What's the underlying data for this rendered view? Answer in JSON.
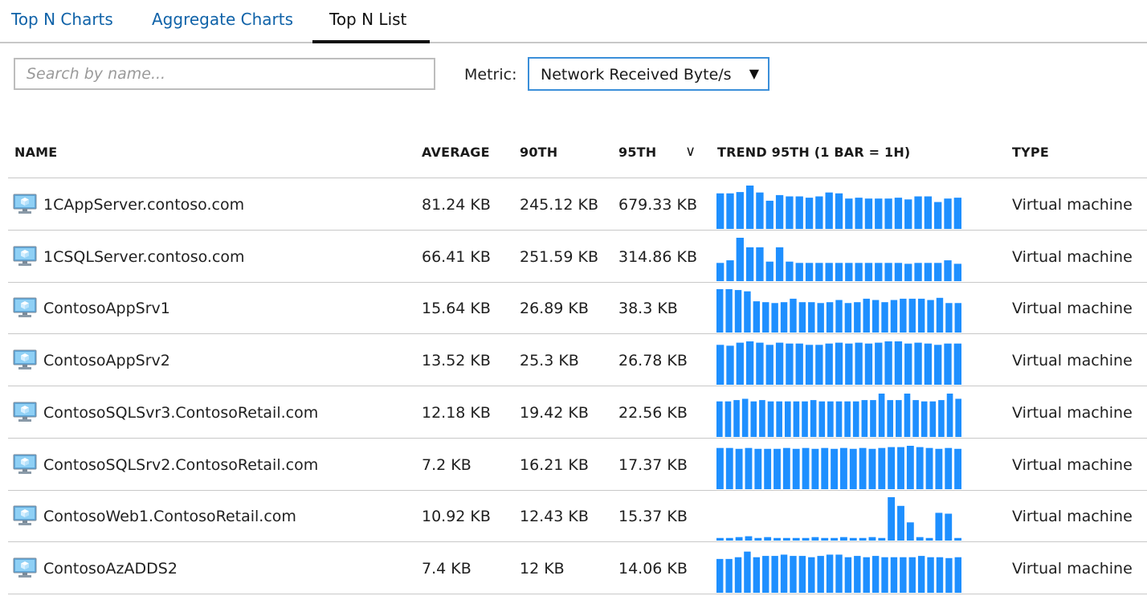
{
  "tabs": [
    {
      "label": "Top N Charts"
    },
    {
      "label": "Aggregate Charts"
    },
    {
      "label": "Top N List"
    }
  ],
  "search": {
    "placeholder": "Search by name...",
    "icon": "none"
  },
  "metric": {
    "label": "Metric:",
    "value": "Network Received Byte/s",
    "caret": "▼"
  },
  "table": {
    "headers": {
      "name": "NAME",
      "average": "AVERAGE",
      "p90": "90TH",
      "p95": "95TH",
      "sort_icon": "∨",
      "trend": "TREND 95TH (1 BAR = 1H)",
      "type": "TYPE"
    },
    "bar_color": "#1e8fff",
    "rows": [
      {
        "name": "1CAppServer.contoso.com",
        "average": "81.24 KB",
        "p90": "245.12 KB",
        "p95": "679.33 KB",
        "type": "Virtual machine",
        "trend": [
          0.82,
          0.82,
          0.85,
          1.0,
          0.84,
          0.65,
          0.78,
          0.75,
          0.75,
          0.72,
          0.75,
          0.84,
          0.82,
          0.7,
          0.72,
          0.7,
          0.7,
          0.7,
          0.72,
          0.68,
          0.75,
          0.75,
          0.62,
          0.7,
          0.72
        ]
      },
      {
        "name": "1CSQLServer.contoso.com",
        "average": "66.41 KB",
        "p90": "251.59 KB",
        "p95": "314.86 KB",
        "type": "Virtual machine",
        "trend": [
          0.42,
          0.48,
          1.0,
          0.78,
          0.78,
          0.45,
          0.78,
          0.45,
          0.42,
          0.42,
          0.42,
          0.42,
          0.42,
          0.42,
          0.42,
          0.42,
          0.42,
          0.42,
          0.42,
          0.4,
          0.42,
          0.42,
          0.42,
          0.48,
          0.4
        ]
      },
      {
        "name": "ContosoAppSrv1",
        "average": "15.64 KB",
        "p90": "26.89 KB",
        "p95": "38.3 KB",
        "type": "Virtual machine",
        "trend": [
          1.0,
          1.0,
          0.98,
          0.95,
          0.72,
          0.7,
          0.68,
          0.7,
          0.78,
          0.7,
          0.7,
          0.68,
          0.7,
          0.75,
          0.68,
          0.7,
          0.78,
          0.75,
          0.7,
          0.75,
          0.78,
          0.78,
          0.78,
          0.75,
          0.8,
          0.68,
          0.68
        ]
      },
      {
        "name": "ContosoAppSrv2",
        "average": "13.52 KB",
        "p90": "25.3 KB",
        "p95": "26.78 KB",
        "type": "Virtual machine",
        "trend": [
          0.92,
          0.9,
          0.97,
          1.0,
          0.97,
          0.92,
          0.97,
          0.95,
          0.95,
          0.92,
          0.92,
          0.95,
          0.97,
          0.95,
          0.97,
          0.95,
          0.97,
          1.0,
          1.0,
          0.95,
          0.97,
          0.95,
          0.92,
          0.95,
          0.95
        ]
      },
      {
        "name": "ContosoSQLSvr3.ContosoRetail.com",
        "average": "12.18 KB",
        "p90": "19.42 KB",
        "p95": "22.56 KB",
        "type": "Virtual machine",
        "trend": [
          0.82,
          0.82,
          0.85,
          0.88,
          0.82,
          0.85,
          0.82,
          0.82,
          0.82,
          0.82,
          0.82,
          0.85,
          0.82,
          0.82,
          0.82,
          0.82,
          0.82,
          0.85,
          0.85,
          1.0,
          0.85,
          0.85,
          1.0,
          0.85,
          0.82,
          0.82,
          0.85,
          1.0,
          0.88
        ]
      },
      {
        "name": "ContosoSQLSrv2.ContosoRetail.com",
        "average": "7.2 KB",
        "p90": "16.21 KB",
        "p95": "17.37 KB",
        "type": "Virtual machine",
        "trend": [
          0.95,
          0.95,
          0.93,
          0.95,
          0.93,
          0.93,
          0.93,
          0.95,
          0.93,
          0.95,
          0.93,
          0.95,
          0.93,
          0.95,
          0.93,
          0.95,
          0.93,
          0.95,
          0.97,
          0.97,
          1.0,
          0.97,
          0.95,
          0.93,
          0.95,
          0.93
        ]
      },
      {
        "name": "ContosoWeb1.ContosoRetail.com",
        "average": "10.92 KB",
        "p90": "12.43 KB",
        "p95": "15.37 KB",
        "type": "Virtual machine",
        "trend": [
          0.06,
          0.06,
          0.08,
          0.1,
          0.06,
          0.08,
          0.06,
          0.06,
          0.06,
          0.06,
          0.08,
          0.06,
          0.06,
          0.08,
          0.06,
          0.06,
          0.08,
          0.06,
          1.0,
          0.8,
          0.42,
          0.08,
          0.06,
          0.64,
          0.62,
          0.06
        ]
      },
      {
        "name": "ContosoAzADDS2",
        "average": "7.4 KB",
        "p90": "12 KB",
        "p95": "14.06 KB",
        "type": "Virtual machine",
        "trend": [
          0.78,
          0.78,
          0.82,
          0.95,
          0.82,
          0.85,
          0.85,
          0.88,
          0.85,
          0.85,
          0.82,
          0.85,
          0.88,
          0.88,
          0.82,
          0.85,
          0.82,
          0.85,
          0.82,
          0.82,
          0.82,
          0.82,
          0.85,
          0.82,
          0.82,
          0.8,
          0.82
        ]
      }
    ]
  }
}
